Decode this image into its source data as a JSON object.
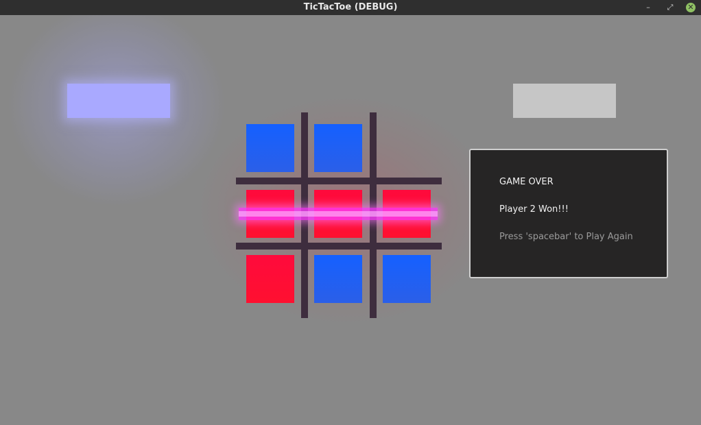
{
  "window": {
    "title": "TicTacToe (DEBUG)",
    "controls": {
      "minimize_glyph": "–",
      "maximize_glyph": "⤢",
      "close_glyph": "✕"
    }
  },
  "game": {
    "board": [
      [
        "blue",
        "blue",
        "empty"
      ],
      [
        "red",
        "red",
        "red"
      ],
      [
        "red",
        "blue",
        "blue"
      ]
    ],
    "winning_row": 1,
    "active_player": 1,
    "colors": {
      "background": "#888888",
      "player1_indicator": "#a9a9ff",
      "player2_indicator": "#c6c6c6",
      "grid": "#3e2d3e",
      "blue_piece": "#1560ff",
      "red_piece": "#ff0a3c",
      "win_line": "#ff3cff"
    }
  },
  "game_over_panel": {
    "title": "GAME OVER",
    "result": "Player 2 Won!!!",
    "hint": "Press 'spacebar' to Play Again"
  }
}
